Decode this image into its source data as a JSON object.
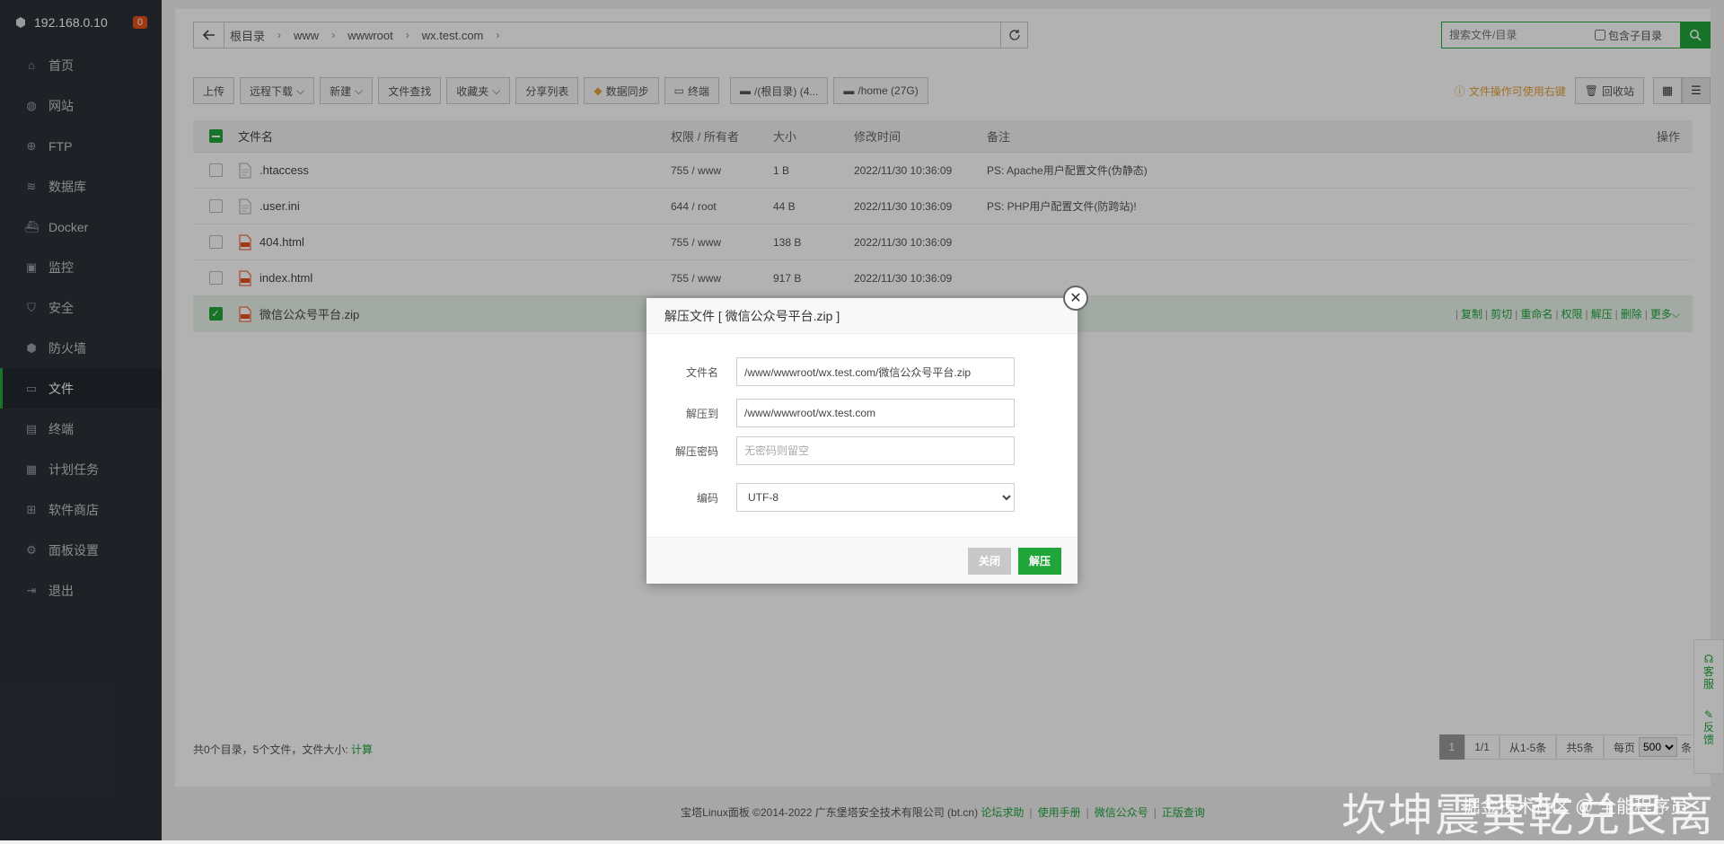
{
  "sidebar": {
    "host": "192.168.0.10",
    "badge": "0",
    "items": [
      {
        "label": "首页",
        "icon": "home-icon"
      },
      {
        "label": "网站",
        "icon": "globe-icon"
      },
      {
        "label": "FTP",
        "icon": "ftp-icon"
      },
      {
        "label": "数据库",
        "icon": "database-icon"
      },
      {
        "label": "Docker",
        "icon": "docker-icon"
      },
      {
        "label": "监控",
        "icon": "monitor-icon"
      },
      {
        "label": "安全",
        "icon": "shield-icon"
      },
      {
        "label": "防火墙",
        "icon": "firewall-icon"
      },
      {
        "label": "文件",
        "icon": "folder-icon"
      },
      {
        "label": "终端",
        "icon": "terminal-icon"
      },
      {
        "label": "计划任务",
        "icon": "calendar-icon"
      },
      {
        "label": "软件商店",
        "icon": "apps-icon"
      },
      {
        "label": "面板设置",
        "icon": "gear-icon"
      },
      {
        "label": "退出",
        "icon": "logout-icon"
      }
    ],
    "active_index": 8
  },
  "breadcrumb": [
    "根目录",
    "www",
    "wwwroot",
    "wx.test.com"
  ],
  "search": {
    "placeholder": "搜索文件/目录",
    "subdir_label": "包含子目录"
  },
  "toolbar": {
    "upload": "上传",
    "remote_download": "远程下载",
    "new": "新建",
    "file_search": "文件查找",
    "favorites": "收藏夹",
    "share_list": "分享列表",
    "data_sync": "数据同步",
    "terminal": "终端",
    "disk_root": "/(根目录) (4...",
    "disk_home": "/home (27G)",
    "tip": "文件操作可使用右键",
    "recycle": "回收站"
  },
  "table": {
    "headers": {
      "name": "文件名",
      "perm": "权限 / 所有者",
      "size": "大小",
      "mtime": "修改时间",
      "note": "备注",
      "ops": "操作"
    },
    "rows": [
      {
        "name": ".htaccess",
        "perm": "755 / www",
        "size": "1 B",
        "mtime": "2022/11/30 10:36:09",
        "note": "PS: Apache用户配置文件(伪静态)",
        "selected": false
      },
      {
        "name": ".user.ini",
        "perm": "644 / root",
        "size": "44 B",
        "mtime": "2022/11/30 10:36:09",
        "note": "PS: PHP用户配置文件(防跨站)!",
        "selected": false
      },
      {
        "name": "404.html",
        "perm": "755 / www",
        "size": "138 B",
        "mtime": "2022/11/30 10:36:09",
        "note": "",
        "selected": false
      },
      {
        "name": "index.html",
        "perm": "755 / www",
        "size": "917 B",
        "mtime": "2022/11/30 10:36:09",
        "note": "",
        "selected": false
      },
      {
        "name": "微信公众号平台.zip",
        "perm": "",
        "size": "",
        "mtime": "",
        "note": "",
        "selected": true
      }
    ],
    "row_ops": [
      "复制",
      "剪切",
      "重命名",
      "权限",
      "解压",
      "删除",
      "更多"
    ]
  },
  "footer_info": {
    "summary": "共0个目录，5个文件，文件大小:",
    "calc": "计算"
  },
  "pager": {
    "current": "1",
    "pages": "1/1",
    "range": "从1-5条",
    "total": "共5条",
    "per_page_label": "每页",
    "per_page": "500",
    "unit": "条"
  },
  "page_footer": {
    "copyright": "宝塔Linux面板 ©2014-2022 广东堡塔安全技术有限公司 (bt.cn)",
    "links": [
      "论坛求助",
      "使用手册",
      "微信公众号",
      "正版查询"
    ]
  },
  "side_float": {
    "service": "客服",
    "feedback": "反馈"
  },
  "modal": {
    "title": "解压文件 [ 微信公众号平台.zip ]",
    "filename_label": "文件名",
    "filename_value": "/www/wwwroot/wx.test.com/微信公众号平台.zip",
    "dest_label": "解压到",
    "dest_value": "/www/wwwroot/wx.test.com",
    "password_label": "解压密码",
    "password_placeholder": "无密码则留空",
    "encoding_label": "编码",
    "encoding_value": "UTF-8",
    "cancel": "关闭",
    "confirm": "解压"
  },
  "watermark": {
    "big": "坎坤震巽乾兑艮离",
    "small": "掘金技术社区 @ 全能程序员"
  },
  "colors": {
    "accent": "#20a53a",
    "sidebar_bg": "#2c3138",
    "warning": "#e6a23c"
  }
}
